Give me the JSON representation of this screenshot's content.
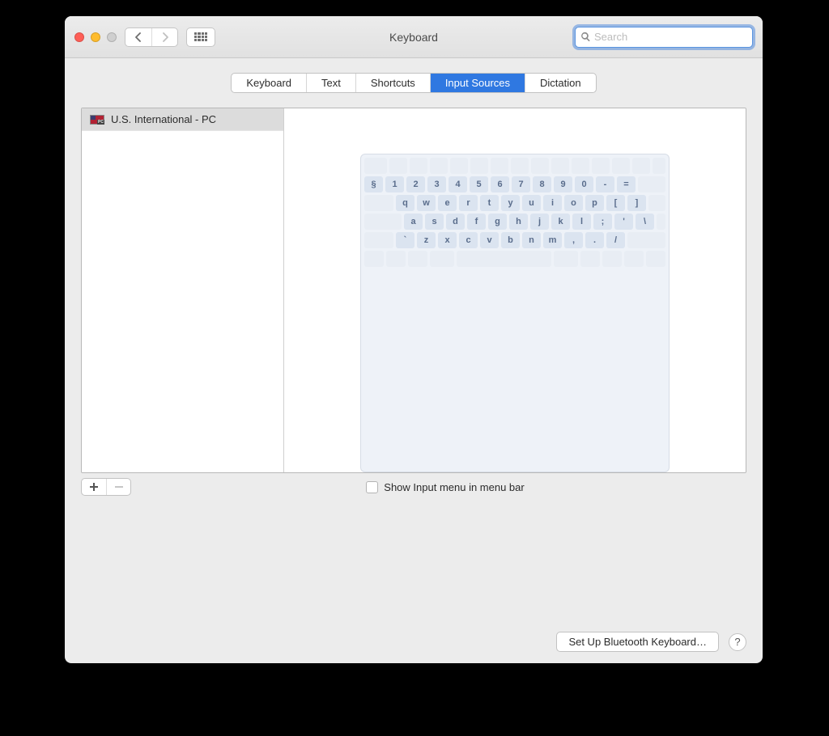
{
  "window": {
    "title": "Keyboard"
  },
  "search": {
    "placeholder": "Search",
    "value": ""
  },
  "tabs": [
    {
      "label": "Keyboard",
      "active": false
    },
    {
      "label": "Text",
      "active": false
    },
    {
      "label": "Shortcuts",
      "active": false
    },
    {
      "label": "Input Sources",
      "active": true
    },
    {
      "label": "Dictation",
      "active": false
    }
  ],
  "input_sources": [
    {
      "label": "U.S. International - PC",
      "flag": "us-pc"
    }
  ],
  "keyboard_layout": {
    "row1": [
      "§",
      "1",
      "2",
      "3",
      "4",
      "5",
      "6",
      "7",
      "8",
      "9",
      "0",
      "-",
      "="
    ],
    "row2": [
      "q",
      "w",
      "e",
      "r",
      "t",
      "y",
      "u",
      "i",
      "o",
      "p",
      "[",
      "]"
    ],
    "row3": [
      "a",
      "s",
      "d",
      "f",
      "g",
      "h",
      "j",
      "k",
      "l",
      ";",
      "'",
      "\\"
    ],
    "row4": [
      "`",
      "z",
      "x",
      "c",
      "v",
      "b",
      "n",
      "m",
      ",",
      ".",
      "/"
    ]
  },
  "show_input_menu": {
    "label": "Show Input menu in menu bar",
    "checked": false
  },
  "buttons": {
    "setup_bluetooth": "Set Up Bluetooth Keyboard…"
  }
}
